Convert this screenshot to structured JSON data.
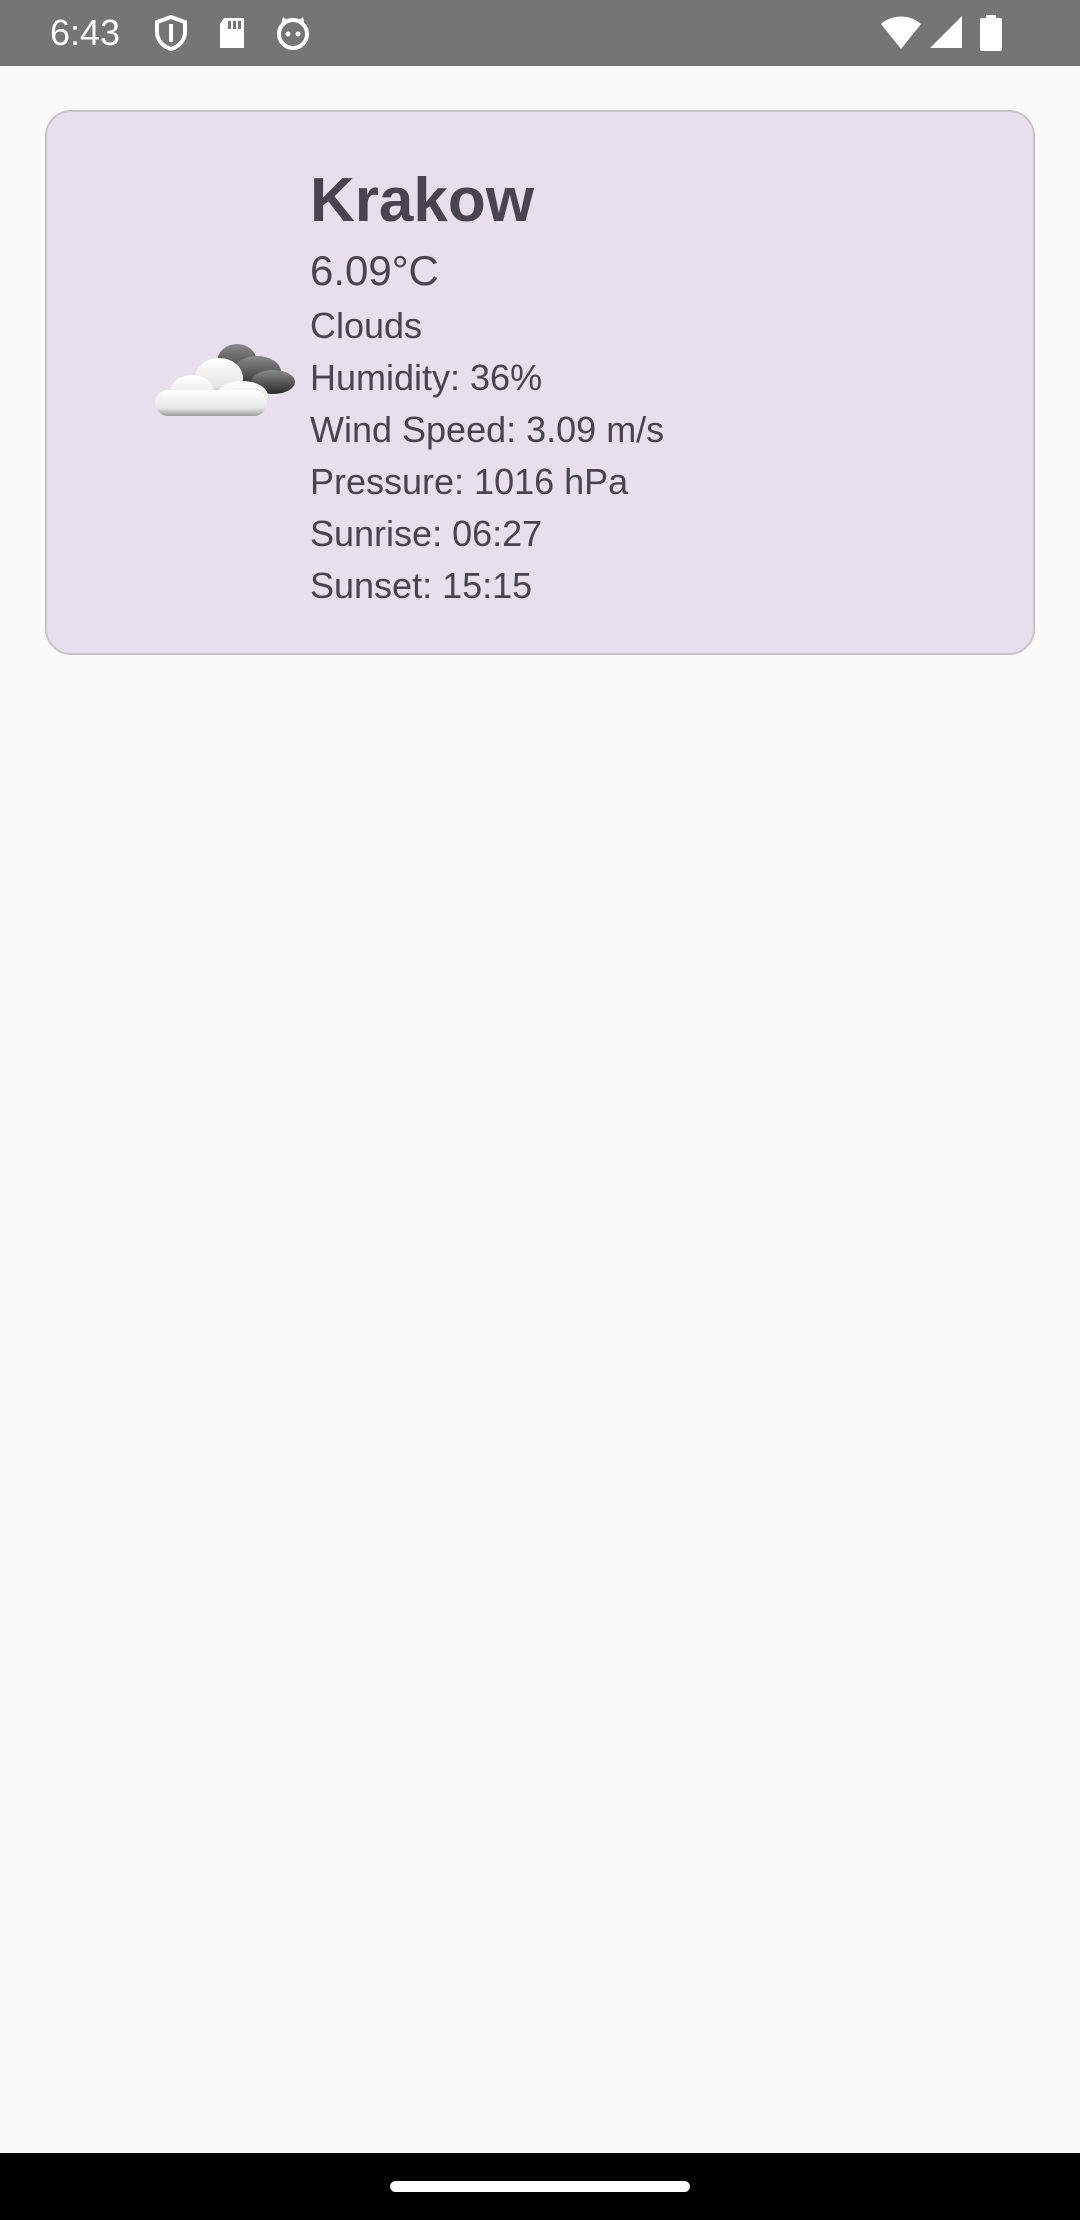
{
  "status_bar": {
    "time": "6:43",
    "left_icons": [
      "shield-icon",
      "sd-card-icon",
      "cat-face-icon"
    ],
    "right_icons": [
      "wifi-icon",
      "cell-signal-icon",
      "battery-icon"
    ],
    "background": "#757575"
  },
  "weather": {
    "city": "Krakow",
    "temperature": "6.09°C",
    "condition": "Clouds",
    "condition_icon": "clouds-icon",
    "humidity": "Humidity: 36%",
    "wind_speed": "Wind Speed: 3.09 m/s",
    "pressure": "Pressure: 1016 hPa",
    "sunrise": "Sunrise: 06:27",
    "sunset": "Sunset: 15:15"
  },
  "colors": {
    "card_background": "#e7dfeb",
    "card_text": "#48454e",
    "page_background": "#fafafa"
  }
}
